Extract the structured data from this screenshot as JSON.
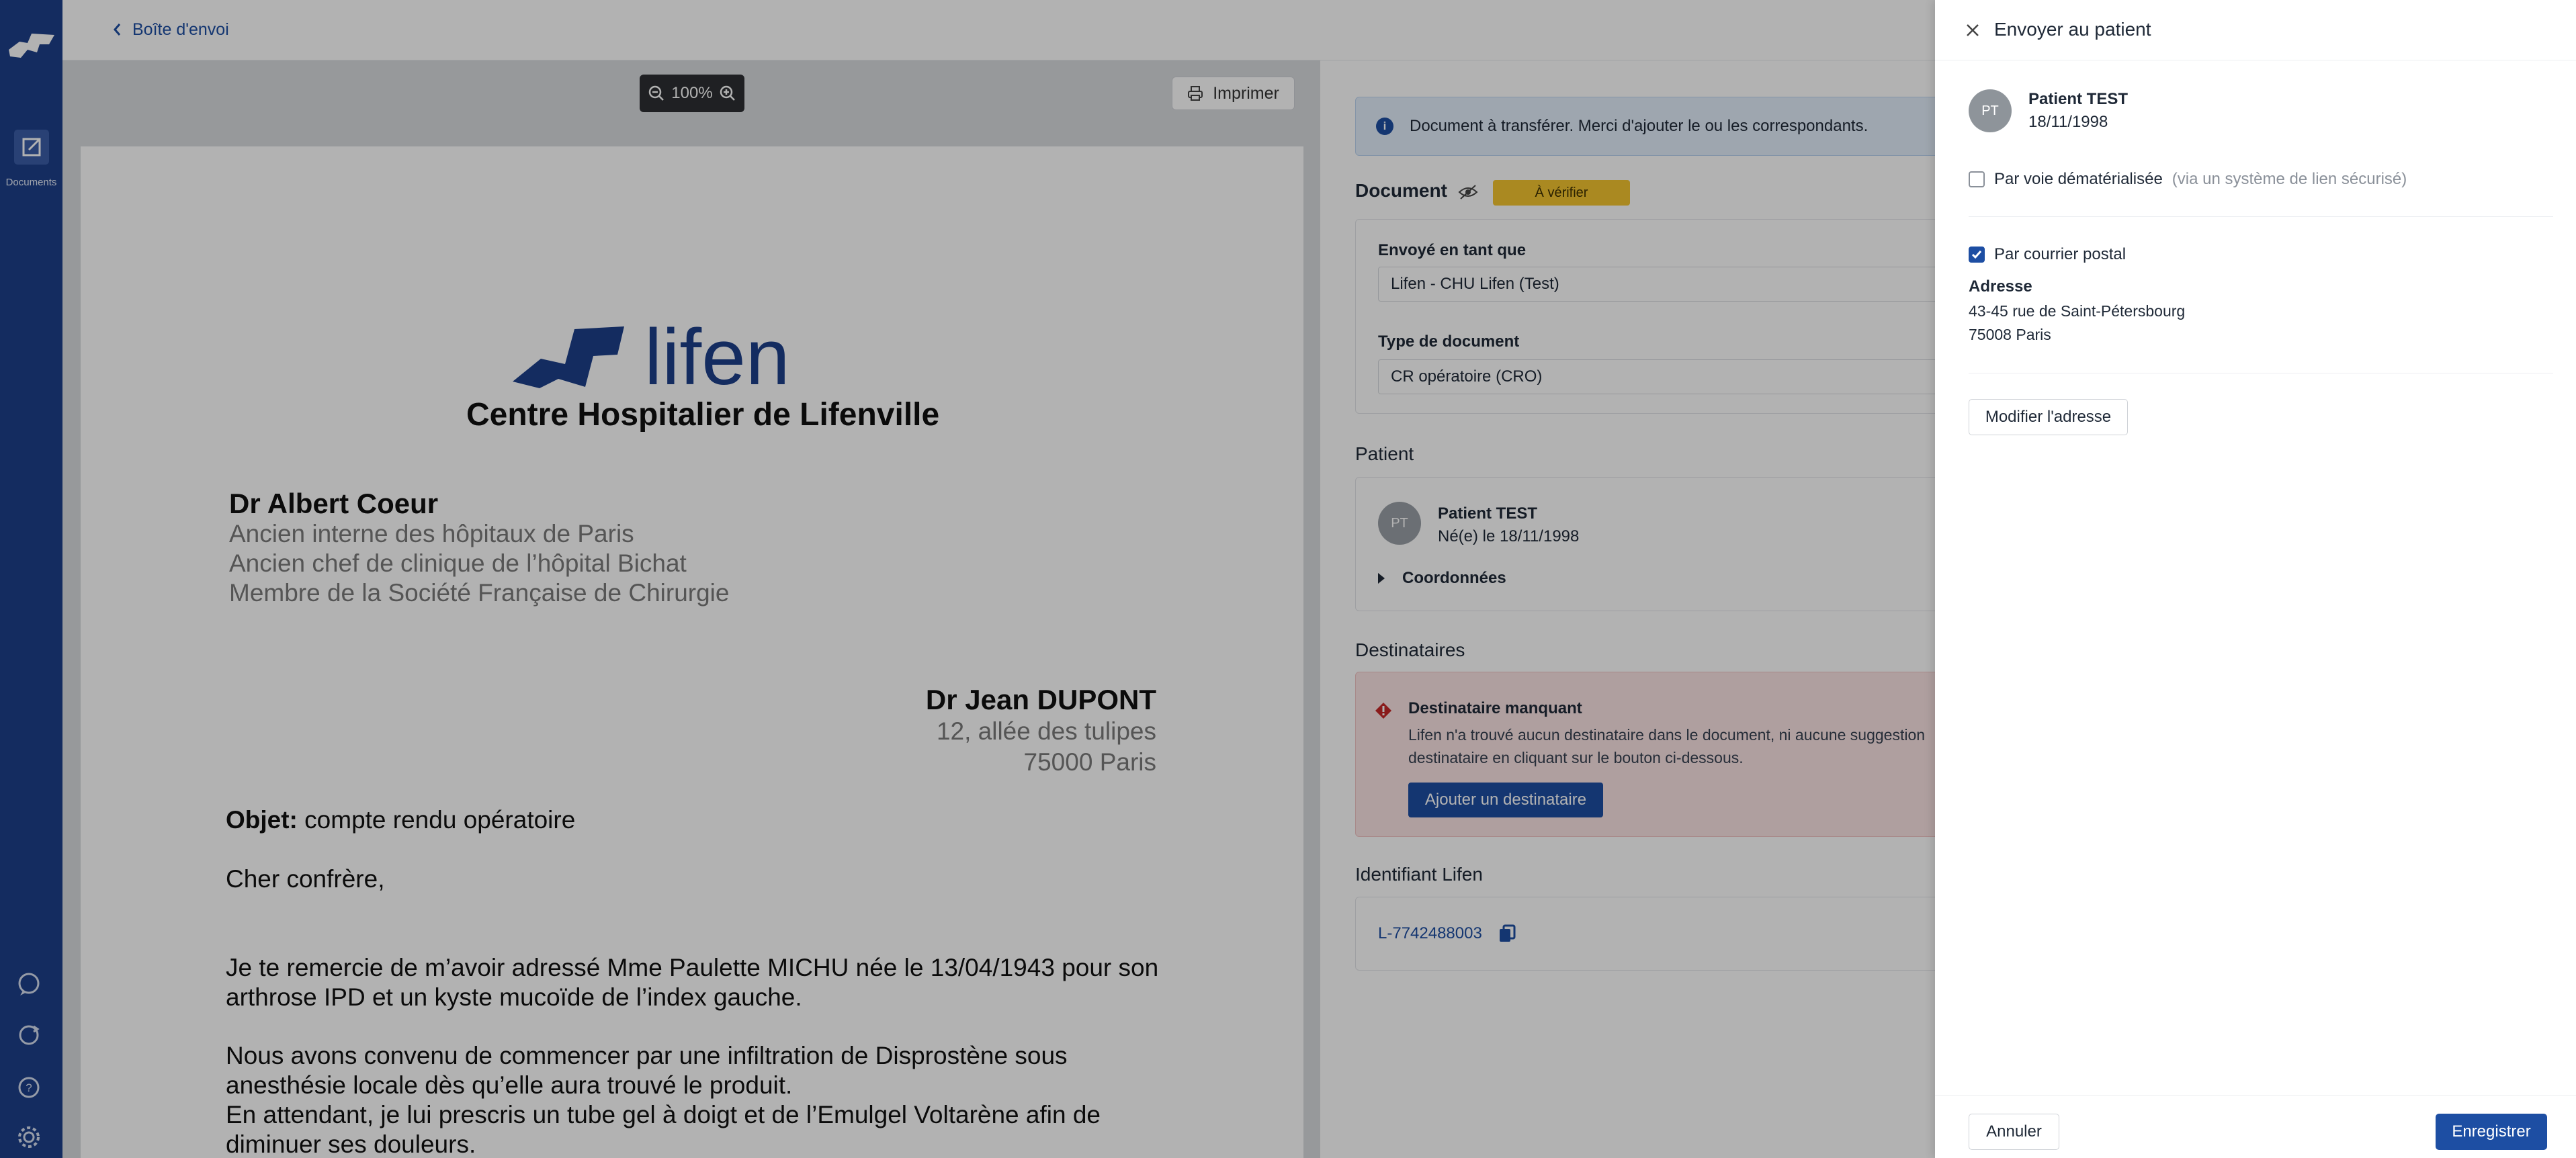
{
  "nav": {
    "back_label": "Boîte d'envoi",
    "documents_label": "Documents"
  },
  "viewer": {
    "zoom_level": "100%",
    "print_label": "Imprimer"
  },
  "letter": {
    "logo_text": "lifen",
    "hospital": "Centre Hospitalier de Lifenville",
    "author_name": "Dr Albert Coeur",
    "author_titles": [
      "Ancien interne des hôpitaux de Paris",
      "Ancien chef de clinique de l’hôpital Bichat",
      "Membre de la Société Française de Chirurgie"
    ],
    "recipient_name": "Dr Jean DUPONT",
    "recipient_lines": [
      "12, allée des tulipes",
      "75000 Paris"
    ],
    "objet_label": "Objet:",
    "objet_text": " compte rendu opératoire",
    "greeting": "Cher confrère,",
    "body_lines": [
      "Je te remercie de m’avoir adressé Mme Paulette MICHU née le 13/04/1943 pour son",
      "arthrose IPD et un kyste mucoïde de l’index gauche.",
      "Nous avons convenu de commencer par une infiltration de Disprostène sous",
      "anesthésie locale dès qu’elle aura trouvé le produit.",
      "En attendant, je lui prescris un tube gel à doigt et de l’Emulgel Voltarène afin de",
      "diminuer ses douleurs."
    ]
  },
  "info": {
    "banner": "Document à transférer. Merci d'ajouter le ou les correspondants.",
    "document_title": "Document",
    "status_badge": "À vérifier",
    "sent_as_label": "Envoyé en tant que",
    "sent_as_value": "Lifen - CHU Lifen (Test)",
    "doc_type_label": "Type de document",
    "doc_type_value": "CR opératoire (CRO)",
    "patient_title": "Patient",
    "patient_initials": "PT",
    "patient_name": "Patient TEST",
    "patient_birth": "Né(e) le 18/11/1998",
    "coordonnees": "Coordonnées",
    "recipients_title": "Destinataires",
    "missing_title": "Destinataire manquant",
    "missing_text_1": "Lifen n'a trouvé aucun destinataire dans le document, ni aucune suggestion",
    "missing_text_2": "destinataire en cliquant sur le bouton ci-dessous.",
    "add_recipient": "Ajouter un destinataire",
    "lifen_id_title": "Identifiant Lifen",
    "lifen_id": "L-7742488003"
  },
  "drawer": {
    "title": "Envoyer au patient",
    "patient_initials": "PT",
    "patient_name": "Patient TEST",
    "patient_birth": "18/11/1998",
    "digital_label": "Par voie dématérialisée",
    "digital_hint": "(via un système de lien sécurisé)",
    "digital_checked": false,
    "postal_label": "Par courrier postal",
    "postal_checked": true,
    "address_label": "Adresse",
    "address_line1": "43-45 rue de Saint-Pétersbourg",
    "address_line2": "75008 Paris",
    "edit_address": "Modifier l'adresse",
    "cancel": "Annuler",
    "save": "Enregistrer"
  },
  "colors": {
    "brand": "#1d4ea3",
    "rail": "#1d3f8a",
    "badge": "#f4c430",
    "error_bg": "#fbe4e4"
  }
}
